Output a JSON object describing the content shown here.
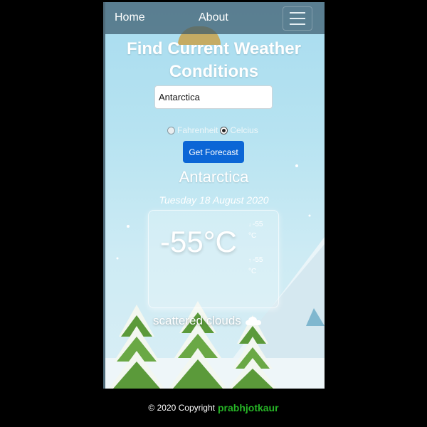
{
  "nav": {
    "home": "Home",
    "about": "About"
  },
  "page": {
    "title": "Find Current Weather Conditions"
  },
  "search": {
    "value": "Antarctica",
    "units": [
      {
        "label": "Fahrenheit",
        "checked": false
      },
      {
        "label": "Celcius",
        "checked": true
      }
    ],
    "button_label": "Get Forecast"
  },
  "weather": {
    "city": "Antarctica",
    "date": "Tuesday 18 August 2020",
    "temperature": "-55°C",
    "max_temp": "-55",
    "max_unit": "°C",
    "min_temp": "-55",
    "min_unit": "°C",
    "description": "scattered clouds",
    "icon": "cloud-icon"
  },
  "footer": {
    "copyright": "© 2020 Copyright",
    "author": "prabhjotkaur"
  },
  "colors": {
    "sky": "#a8dcef",
    "button": "#0b66d6",
    "author": "#26b526"
  }
}
